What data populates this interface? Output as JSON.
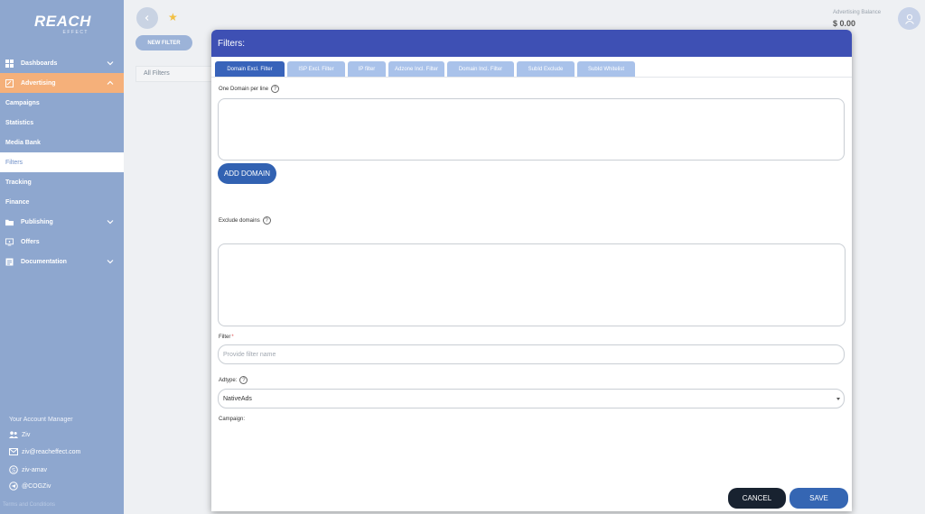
{
  "brand": {
    "logo_main": "REACH",
    "logo_sub": "EFFECT"
  },
  "sidebar": {
    "items": [
      {
        "label": "Dashboards",
        "icon": "dashboard-icon"
      },
      {
        "label": "Advertising",
        "icon": "advertising-icon"
      },
      {
        "label": "Campaigns"
      },
      {
        "label": "Statistics"
      },
      {
        "label": "Media Bank"
      },
      {
        "label": "Filters"
      },
      {
        "label": "Tracking"
      },
      {
        "label": "Finance"
      },
      {
        "label": "Publishing",
        "icon": "folder-icon"
      },
      {
        "label": "Offers",
        "icon": "offers-icon"
      },
      {
        "label": "Documentation",
        "icon": "document-icon"
      }
    ],
    "account_manager_label": "Your Account Manager",
    "manager_name": "Ziv",
    "manager_email": "ziv@reacheffect.com",
    "manager_skype": "ziv-amav",
    "manager_telegram": "@COGZiv",
    "terms": "Terms and Conditions"
  },
  "top": {
    "new_filter": "NEW FILTER",
    "all_filters": "All Filters",
    "balance_label": "Advertising Balance",
    "balance_value": "$ 0.00"
  },
  "modal": {
    "title": "Filters:",
    "tabs": [
      "Domain Excl. Filter",
      "ISP Excl. Filter",
      "IP filter",
      "Adzone Incl. Filter",
      "Domain Incl. Filter",
      "SubId Exclude",
      "SubId Whitelist"
    ],
    "domain_label": "One Domain per line",
    "add_domain": "ADD DOMAIN",
    "exclude_label": "Exclude domains",
    "filter_label": "Filter",
    "filter_required": "*",
    "filter_placeholder": "Provide filter name",
    "adtype_label": "Adtype:",
    "adtype_value": "NativeAds",
    "campaign_label": "Campaign:",
    "cancel": "CANCEL",
    "save": "SAVE"
  },
  "colors": {
    "sidebar": "#8ea7cf",
    "active_parent": "#f5b07a",
    "modal_header": "#3e50b4",
    "active_tab": "#3863ba",
    "tab": "#a9c2ea",
    "primary_button": "#3566b3",
    "cancel_button": "#182230"
  }
}
